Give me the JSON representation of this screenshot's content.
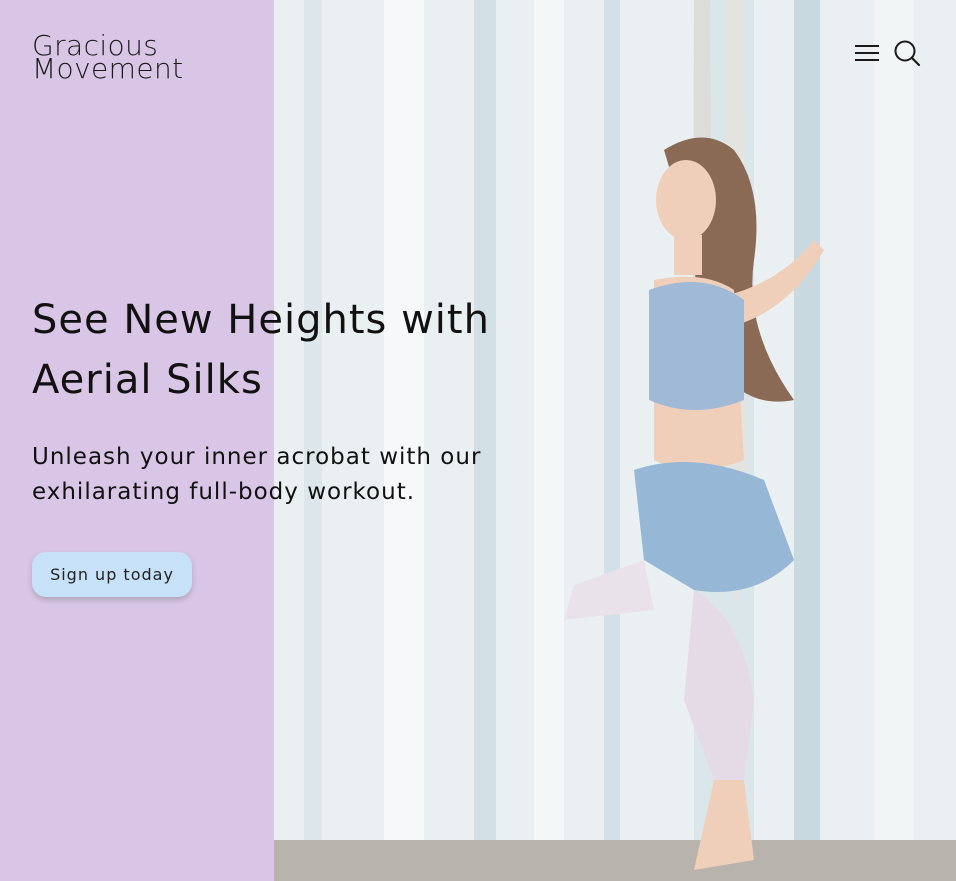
{
  "brand": {
    "line1": "Gracious",
    "line2": "Movement"
  },
  "header": {
    "menu_icon": "hamburger-menu-icon",
    "search_icon": "search-icon"
  },
  "hero": {
    "headline_line1": "See New Heights with",
    "headline_line2": "Aerial Silks",
    "subtext_line1": "Unleash your inner acrobat with our",
    "subtext_line2": "exhilarating full-body workout.",
    "cta_label": "Sign up today"
  },
  "colors": {
    "panel": "#d9c6e6",
    "button": "#c6e1f8",
    "text": "#111111"
  }
}
